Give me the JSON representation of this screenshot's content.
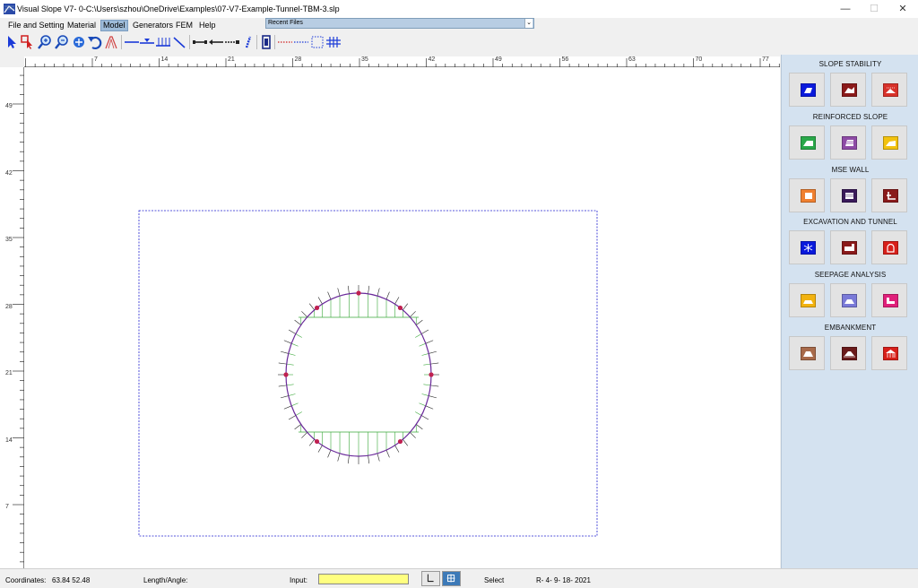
{
  "window": {
    "title": "Visual Slope V7- 0-C:\\Users\\szhou\\OneDrive\\Examples\\07-V7-Example-Tunnel-TBM-3.slp",
    "minimize": "—",
    "maximize": "☐",
    "close": "✕"
  },
  "menu": {
    "items": [
      "File and Setting",
      "Material",
      "Model",
      "Generators",
      "FEM",
      "Help"
    ],
    "active": "Model"
  },
  "recent_files": {
    "label": "Recent Files"
  },
  "toolbar": {
    "icons": [
      "select-arrow-icon",
      "select-node-icon",
      "zoom-in-icon",
      "zoom-out-icon",
      "pan-icon",
      "undo-icon",
      "slope-icon",
      "line-icon",
      "water-table-icon",
      "support-icon",
      "diagonal-line-icon",
      "anchor-icon",
      "nail-icon",
      "geogrid-icon",
      "pile-icon",
      "wall-icon",
      "red-dotted-line-icon",
      "blue-dotted-line-icon",
      "rectangle-select-icon",
      "grid-icon"
    ]
  },
  "ruler": {
    "h_labels": [
      "7",
      "14",
      "21",
      "28",
      "35",
      "42",
      "49",
      "56",
      "63",
      "70",
      "77"
    ],
    "v_labels": [
      "49",
      "42",
      "35",
      "28",
      "21",
      "14",
      "7"
    ]
  },
  "panel": {
    "sections": [
      {
        "title": "SLOPE STABILITY",
        "buttons": [
          {
            "name": "slope-stability-1-icon",
            "color": "#0a1adc"
          },
          {
            "name": "slope-stability-2-icon",
            "color": "#8b1a1a"
          },
          {
            "name": "slope-stability-3-icon",
            "color": "#d8322a"
          }
        ]
      },
      {
        "title": "REINFORCED SLOPE",
        "buttons": [
          {
            "name": "reinforced-slope-1-icon",
            "color": "#2aa84a"
          },
          {
            "name": "reinforced-slope-2-icon",
            "color": "#8e4ba6"
          },
          {
            "name": "reinforced-slope-3-icon",
            "color": "#f2c20f"
          }
        ]
      },
      {
        "title": "MSE WALL",
        "buttons": [
          {
            "name": "mse-wall-1-icon",
            "color": "#f08030"
          },
          {
            "name": "mse-wall-2-icon",
            "color": "#3a1a5a"
          },
          {
            "name": "mse-wall-3-icon",
            "color": "#8a1a1a"
          }
        ]
      },
      {
        "title": "EXCAVATION AND TUNNEL",
        "buttons": [
          {
            "name": "excavation-1-icon",
            "color": "#0a1adc"
          },
          {
            "name": "excavation-2-icon",
            "color": "#8a1a1a"
          },
          {
            "name": "tunnel-icon",
            "color": "#d8201a"
          }
        ]
      },
      {
        "title": "SEEPAGE ANALYSIS",
        "buttons": [
          {
            "name": "seepage-1-icon",
            "color": "#f2b20f"
          },
          {
            "name": "seepage-2-icon",
            "color": "#7a7ad8"
          },
          {
            "name": "seepage-3-icon",
            "color": "#e0207a"
          }
        ]
      },
      {
        "title": "EMBANKMENT",
        "buttons": [
          {
            "name": "embankment-1-icon",
            "color": "#a86a4a"
          },
          {
            "name": "embankment-2-icon",
            "color": "#6a1a1a"
          },
          {
            "name": "embankment-3-icon",
            "color": "#d8201a"
          }
        ]
      }
    ]
  },
  "status": {
    "coordinates_label": "Coordinates:",
    "coordinates_value": "63.84  52.48",
    "length_label": "Length/Angle:",
    "input_label": "Input:",
    "input_value": "",
    "mode": "Select",
    "version": "R- 4- 9- 18- 2021"
  },
  "colors": {
    "boundary": "#2020d0",
    "tunnel": "#6a2a9a",
    "load_marks": "#3aa83a",
    "nodes": "#c02050",
    "ticks": "#222222"
  }
}
